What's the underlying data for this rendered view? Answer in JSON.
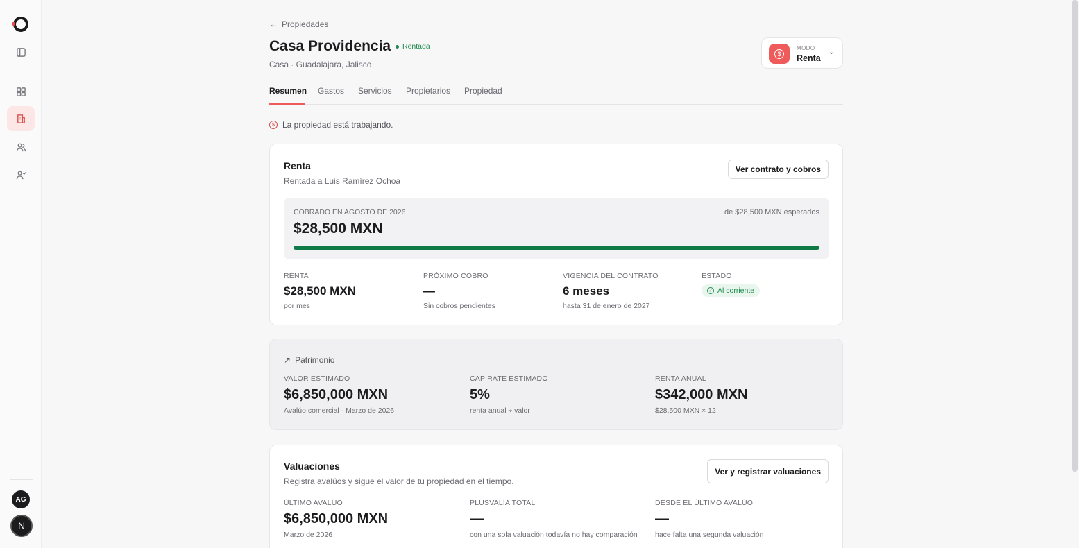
{
  "sidebar": {
    "avatar_initials": "AG",
    "badge_letter": "N",
    "icons": [
      "logo-icon",
      "panel-toggle-icon",
      "grid-icon",
      "building-icon",
      "users-icon",
      "user-check-icon"
    ]
  },
  "header": {
    "back_label": "Propiedades",
    "title": "Casa Providencia",
    "status": "Rentada",
    "subtitle": "Casa · Guadalajara, Jalisco"
  },
  "mode": {
    "label": "MODO",
    "value": "Renta"
  },
  "tabs": [
    {
      "label": "Resumen",
      "active": true
    },
    {
      "label": "Gastos",
      "active": false
    },
    {
      "label": "Servicios",
      "active": false
    },
    {
      "label": "Propietarios",
      "active": false
    },
    {
      "label": "Propiedad",
      "active": false
    }
  ],
  "status_message": "La propiedad está trabajando.",
  "renta": {
    "title": "Renta",
    "description": "Rentada a Luis Ramírez Ochoa",
    "button": "Ver contrato y cobros",
    "collected_label": "COBRADO EN AGOSTO DE 2026",
    "collected_value": "$28,500 MXN",
    "expected": "de $28,500 MXN esperados",
    "progress_pct": 100,
    "stats": [
      {
        "label": "RENTA",
        "value": "$28,500 MXN",
        "sub": "por mes"
      },
      {
        "label": "PRÓXIMO COBRO",
        "value": "—",
        "sub": "Sin cobros pendientes"
      },
      {
        "label": "VIGENCIA DEL CONTRATO",
        "value": "6 meses",
        "sub": "hasta 31 de enero de 2027"
      },
      {
        "label": "ESTADO",
        "pill": "Al corriente"
      }
    ]
  },
  "patrimonio": {
    "title": "Patrimonio",
    "stats": [
      {
        "label": "VALOR ESTIMADO",
        "value": "$6,850,000 MXN",
        "sub": "Avalúo comercial · Marzo de 2026"
      },
      {
        "label": "CAP RATE ESTIMADO",
        "value": "5%",
        "sub": "renta anual ÷ valor"
      },
      {
        "label": "RENTA ANUAL",
        "value": "$342,000 MXN",
        "sub": "$28,500 MXN × 12"
      }
    ]
  },
  "valuaciones": {
    "title": "Valuaciones",
    "description": "Registra avalúos y sigue el valor de tu propiedad en el tiempo.",
    "button": "Ver y registrar valuaciones",
    "stats": [
      {
        "label": "ÚLTIMO AVALÚO",
        "value": "$6,850,000 MXN",
        "sub": "Marzo de 2026"
      },
      {
        "label": "PLUSVALÍA TOTAL",
        "value": "—",
        "sub": "con una sola valuación todavía no hay comparación"
      },
      {
        "label": "DESDE EL ÚLTIMO AVALÚO",
        "value": "—",
        "sub": "hace falta una segunda valuación"
      }
    ]
  }
}
